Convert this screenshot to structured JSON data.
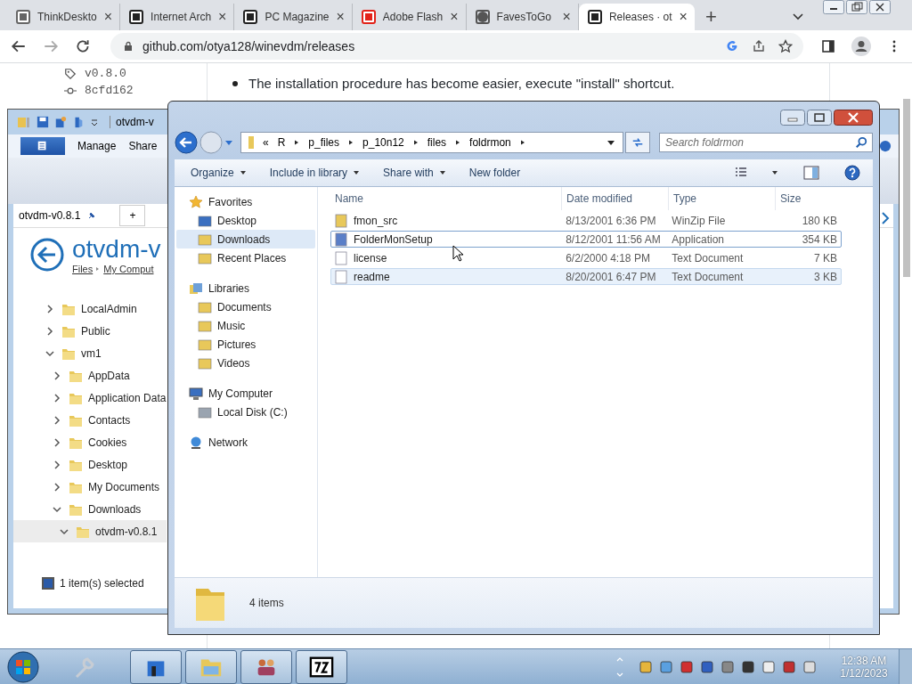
{
  "browser": {
    "tabs": [
      {
        "label": "ThinkDeskto",
        "selected": false
      },
      {
        "label": "Internet Arch",
        "selected": false
      },
      {
        "label": "PC Magazine",
        "selected": false
      },
      {
        "label": "Adobe Flash",
        "selected": false
      },
      {
        "label": "FavesToGo",
        "selected": false
      },
      {
        "label": "Releases · ot",
        "selected": true
      }
    ],
    "tab_close": "×",
    "new_tab": "+",
    "forward_disabled": true,
    "address": "github.com/otya128/winevdm/releases"
  },
  "page": {
    "tag": "v0.8.0",
    "commit": "8cfd162",
    "bullet": "The installation procedure has become easier, execute \"install\" shortcut."
  },
  "back_window": {
    "title": "otvdm-v",
    "ribbon_tabs": [
      "Manage",
      "Share"
    ],
    "tab": "otvdm-v0.8.1",
    "new_tab": "+",
    "heading": "otvdm-v",
    "breadcrumb": [
      "Files",
      "My Comput"
    ],
    "tree": [
      {
        "label": "LocalAdmin",
        "expanded": false,
        "selected": false
      },
      {
        "label": "Public",
        "expanded": false,
        "selected": false
      },
      {
        "label": "vm1",
        "expanded": true,
        "selected": false,
        "children": [
          {
            "label": "AppData",
            "expanded": false,
            "selected": false
          },
          {
            "label": "Application Data",
            "expanded": false,
            "selected": false
          },
          {
            "label": "Contacts",
            "expanded": false,
            "selected": false
          },
          {
            "label": "Cookies",
            "expanded": false,
            "selected": false
          },
          {
            "label": "Desktop",
            "expanded": false,
            "selected": false
          },
          {
            "label": "My Documents",
            "expanded": false,
            "selected": false
          },
          {
            "label": "Downloads",
            "expanded": true,
            "selected": false,
            "children": [
              {
                "label": "otvdm-v0.8.1",
                "expanded": true,
                "selected": true
              }
            ]
          }
        ]
      }
    ],
    "status": "1 item(s) selected"
  },
  "front_window": {
    "path_overflow": "«",
    "path": [
      "R",
      "p_files",
      "p_10n12",
      "files",
      "foldrmon"
    ],
    "search_placeholder": "Search foldrmon",
    "toolbar": [
      {
        "label": "Organize",
        "menu": true
      },
      {
        "label": "Include in library",
        "menu": true
      },
      {
        "label": "Share with",
        "menu": true
      },
      {
        "label": "New folder",
        "menu": false
      }
    ],
    "nav": [
      {
        "label": "Favorites",
        "items": [
          {
            "label": "Desktop",
            "selected": false
          },
          {
            "label": "Downloads",
            "selected": true
          },
          {
            "label": "Recent Places",
            "selected": false
          }
        ]
      },
      {
        "label": "Libraries",
        "items": [
          {
            "label": "Documents",
            "selected": false
          },
          {
            "label": "Music",
            "selected": false
          },
          {
            "label": "Pictures",
            "selected": false
          },
          {
            "label": "Videos",
            "selected": false
          }
        ]
      },
      {
        "label": "My Computer",
        "items": [
          {
            "label": "Local Disk (C:)",
            "selected": false
          }
        ]
      },
      {
        "label": "Network"
      }
    ],
    "columns": [
      "Name",
      "Date modified",
      "Type",
      "Size"
    ],
    "files": [
      {
        "name": "fmon_src",
        "date": "8/13/2001 6:36 PM",
        "type": "WinZip File",
        "size": "180 KB",
        "selected": false,
        "hovered": false
      },
      {
        "name": "FolderMonSetup",
        "date": "8/12/2001 11:56 AM",
        "type": "Application",
        "size": "354 KB",
        "selected": false,
        "hovered": true
      },
      {
        "name": "license",
        "date": "6/2/2000 4:18 PM",
        "type": "Text Document",
        "size": "7 KB",
        "selected": false,
        "hovered": false
      },
      {
        "name": "readme",
        "date": "8/20/2001 6:47 PM",
        "type": "Text Document",
        "size": "3 KB",
        "selected": true,
        "hovered": false
      }
    ],
    "status": "4 items"
  },
  "taskbar": {
    "time": "12:38 AM",
    "date": "1/12/2023"
  }
}
